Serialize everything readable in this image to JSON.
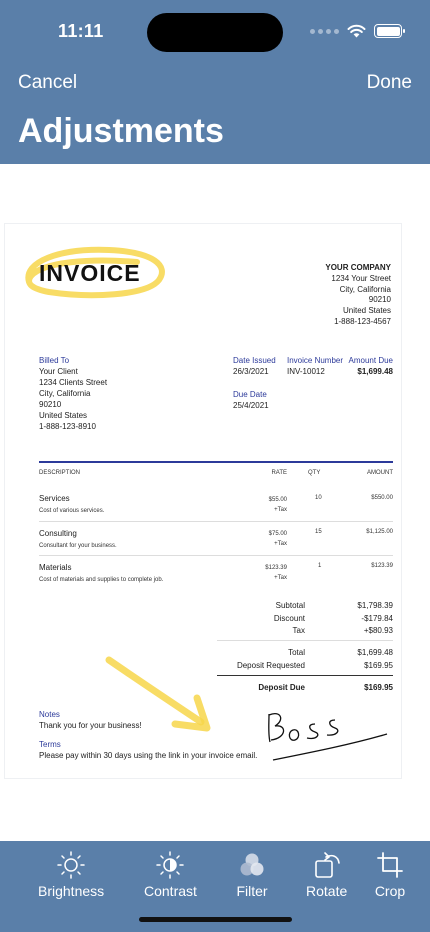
{
  "status": {
    "time": "11:11"
  },
  "nav": {
    "cancel": "Cancel",
    "done": "Done",
    "title": "Adjustments"
  },
  "invoice": {
    "title": "INVOICE",
    "company": [
      "YOUR COMPANY",
      "1234 Your Street",
      "City, California",
      "90210",
      "United States",
      "1-888-123-4567"
    ],
    "billed_to": {
      "label": "Billed To",
      "lines": [
        "Your Client",
        "1234 Clients Street",
        "City, California",
        "90210",
        "United States",
        "1-888-123-8910"
      ]
    },
    "date_issued": {
      "label": "Date Issued",
      "value": "26/3/2021"
    },
    "invoice_number": {
      "label": "Invoice Number",
      "value": "INV-10012"
    },
    "amount_due": {
      "label": "Amount Due",
      "value": "$1,699.48"
    },
    "due_date": {
      "label": "Due Date",
      "value": "25/4/2021"
    },
    "columns": {
      "description": "DESCRIPTION",
      "rate": "RATE",
      "qty": "QTY",
      "amount": "AMOUNT"
    },
    "items": [
      {
        "name": "Services",
        "desc": "Cost of various services.",
        "rate": "$55.00",
        "tax": "+Tax",
        "qty": "10",
        "amount": "$550.00"
      },
      {
        "name": "Consulting",
        "desc": "Consultant for your business.",
        "rate": "$75.00",
        "tax": "+Tax",
        "qty": "15",
        "amount": "$1,125.00"
      },
      {
        "name": "Materials",
        "desc": "Cost of materials and supplies to complete job.",
        "rate": "$123.39",
        "tax": "+Tax",
        "qty": "1",
        "amount": "$123.39"
      }
    ],
    "totals": {
      "subtotal": {
        "label": "Subtotal",
        "value": "$1,798.39"
      },
      "discount": {
        "label": "Discount",
        "value": "-$179.84"
      },
      "tax": {
        "label": "Tax",
        "value": "+$80.93"
      },
      "total": {
        "label": "Total",
        "value": "$1,699.48"
      },
      "deposit": {
        "label": "Deposit Requested",
        "value": "$169.95"
      },
      "deposit_due": {
        "label": "Deposit Due",
        "value": "$169.95"
      }
    },
    "notes": {
      "label": "Notes",
      "text": "Thank you for your business!"
    },
    "terms": {
      "label": "Terms",
      "text": "Please pay within 30 days using the link in your invoice email."
    },
    "signature": "Boss",
    "highlight_color": "#f7d64a",
    "accent_color": "#2c3a9a"
  },
  "toolbar": {
    "brightness": "Brightness",
    "contrast": "Contrast",
    "filter": "Filter",
    "rotate": "Rotate",
    "crop": "Crop"
  },
  "colors": {
    "bar": "#5a7fa9"
  }
}
